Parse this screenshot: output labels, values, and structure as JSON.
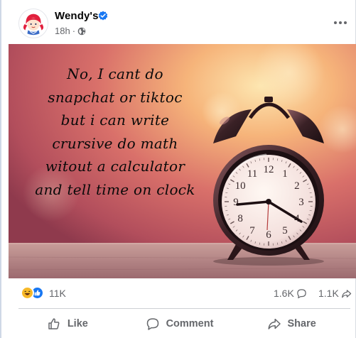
{
  "post": {
    "page_name": "Wendy's",
    "time": "18h",
    "separator": "·",
    "image_text_lines": [
      "No, I cant do",
      "snapchat or tiktoc",
      "but i can write",
      "crursive do math",
      "witout a calculator",
      "and tell time on clock"
    ],
    "clock_numbers": [
      "12",
      "1",
      "2",
      "3",
      "4",
      "5",
      "6",
      "7",
      "8",
      "9",
      "10",
      "11"
    ]
  },
  "stats": {
    "reaction_count": "11K",
    "comment_count": "1.6K",
    "share_count": "1.1K"
  },
  "actions": {
    "like": "Like",
    "comment": "Comment",
    "share": "Share"
  },
  "colors": {
    "verified": "#1877f2",
    "like_blue": "#1877f2",
    "haha_yellow": "#f7b928",
    "secondary_text": "#65676b",
    "wendys_red": "#e2203d"
  },
  "icons": {
    "verified": "verified-badge-icon",
    "audience": "globe-icon",
    "more": "more-options-icon",
    "haha": "haha-reaction-icon",
    "like_reaction": "like-reaction-icon",
    "comment": "comment-icon",
    "share": "share-icon",
    "like": "thumbs-up-icon"
  }
}
